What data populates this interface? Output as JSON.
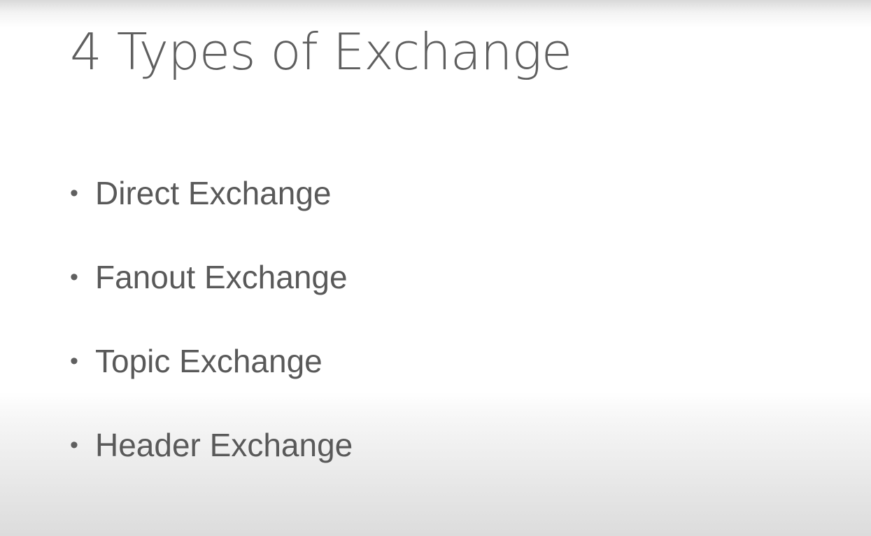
{
  "slide": {
    "title": "4 Types of Exchange",
    "bullets": [
      {
        "label": "Direct Exchange"
      },
      {
        "label": "Fanout Exchange"
      },
      {
        "label": "Topic Exchange"
      },
      {
        "label": "Header Exchange"
      }
    ],
    "bullet_glyph": "•",
    "colors": {
      "text": "#595959",
      "background": "#ffffff"
    }
  }
}
